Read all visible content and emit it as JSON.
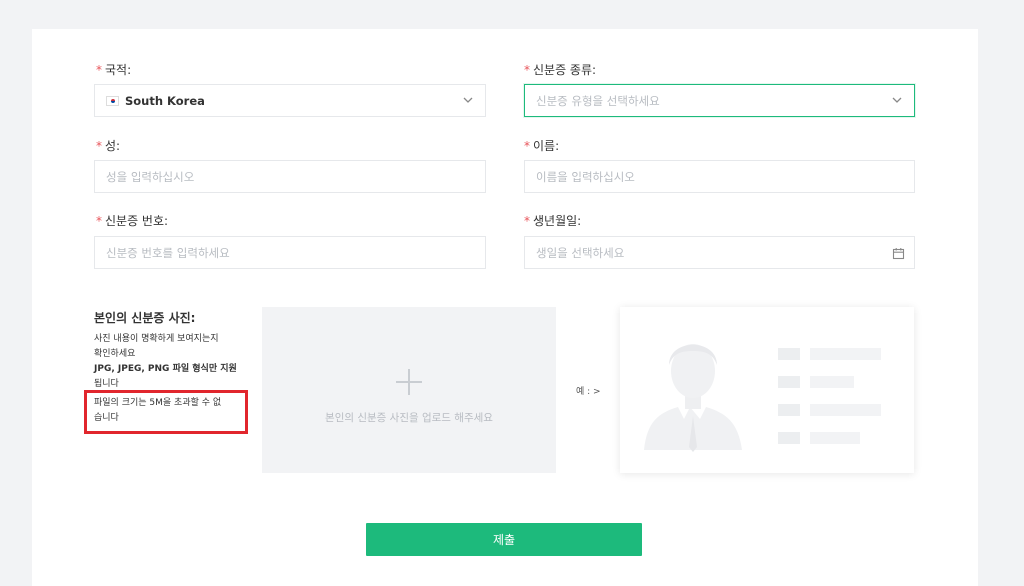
{
  "form": {
    "nationality": {
      "label": "국적:",
      "value": "South Korea"
    },
    "id_type": {
      "label": "신분증 종류:",
      "placeholder": "신분증 유형을 선택하세요"
    },
    "last_name": {
      "label": "성:",
      "placeholder": "성을 입력하십시오"
    },
    "first_name": {
      "label": "이름:",
      "placeholder": "이름을 입력하십시오"
    },
    "id_number": {
      "label": "신분증 번호:",
      "placeholder": "신분증 번호를 입력하세요"
    },
    "birth_date": {
      "label": "생년월일:",
      "placeholder": "생일을 선택하세요"
    },
    "required_mark": "*"
  },
  "upload": {
    "title": "본인의 신분증 사진:",
    "req_line1": "사진 내용이 명확하게 보여지는지",
    "req_line2": "확인하세요",
    "req_line3": "JPG, JPEG, PNG 파일 형식만 지원",
    "req_line4": "됩니다",
    "size_line1": "파일의 크기는 5M을 초과할 수 없",
    "size_line2": "습니다",
    "hint": "본인의 신분증 사진을 업로드 해주세요",
    "example_label": "예 : >"
  },
  "submit_label": "제출",
  "colors": {
    "accent": "#1dba7c",
    "required": "#e8545a",
    "highlight": "#e1262d"
  }
}
